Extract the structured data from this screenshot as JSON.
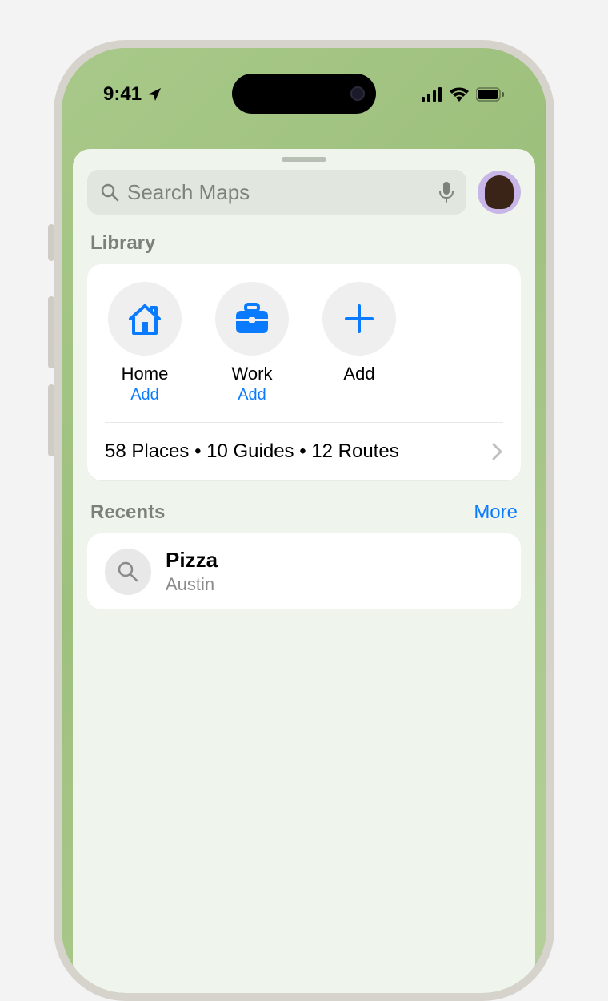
{
  "status": {
    "time": "9:41"
  },
  "search": {
    "placeholder": "Search Maps"
  },
  "library": {
    "title": "Library",
    "favorites": [
      {
        "label": "Home",
        "action": "Add",
        "icon": "house"
      },
      {
        "label": "Work",
        "action": "Add",
        "icon": "briefcase"
      },
      {
        "label": "Add",
        "action": "",
        "icon": "plus"
      }
    ],
    "summary": "58 Places  • 10 Guides  • 12 Routes"
  },
  "recents": {
    "title": "Recents",
    "more": "More",
    "items": [
      {
        "title": "Pizza",
        "subtitle": "Austin"
      }
    ]
  }
}
